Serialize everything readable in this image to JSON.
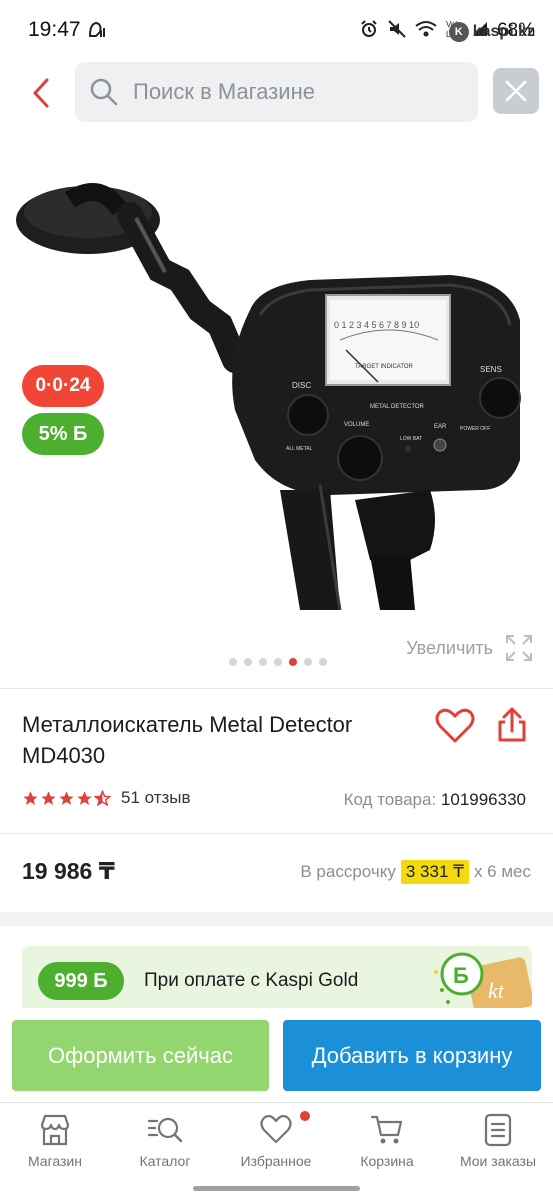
{
  "status_bar": {
    "time": "19:47",
    "battery": "68%",
    "overlay_text": "kaspi.kz"
  },
  "header": {
    "search_placeholder": "Поиск в Магазине"
  },
  "gallery": {
    "installment_badge": "0·0·24",
    "bonus_badge": "5% Б",
    "zoom_label": "Увеличить",
    "image_count": 7,
    "active_image": 6
  },
  "product": {
    "title": "Металлоискатель Metal Detector MD4030",
    "rating": 4.5,
    "reviews": "51 отзыв",
    "sku_label": "Код товара:",
    "sku_value": "101996330",
    "price": "19 986 ₸",
    "installment_prefix": "В рассрочку",
    "installment_amount": "3 331 ₸",
    "installment_suffix": "x 6 мес"
  },
  "kaspi_gold": {
    "badge": "999 Б",
    "text": "При оплате с Kaspi Gold"
  },
  "actions": {
    "checkout": "Оформить сейчас",
    "add_to_cart": "Добавить в корзину"
  },
  "nav": {
    "items": [
      {
        "label": "Магазин"
      },
      {
        "label": "Каталог"
      },
      {
        "label": "Избранное"
      },
      {
        "label": "Корзина"
      },
      {
        "label": "Мои заказы"
      }
    ]
  },
  "colors": {
    "accent_red": "#e23f3a",
    "bonus_green": "#4caf2f",
    "checkout_green": "#93d56f",
    "cart_blue": "#1b8fd8",
    "installment_yellow": "#f4d90e"
  }
}
